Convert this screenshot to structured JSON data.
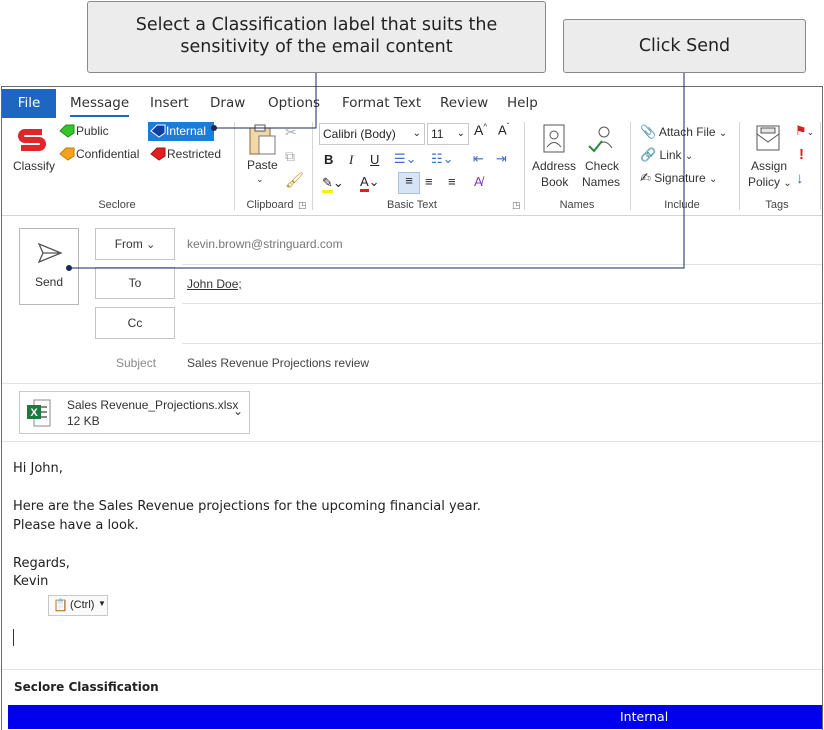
{
  "callouts": {
    "classify_line1": "Select a Classification label that suits the",
    "classify_line2": "sensitivity of the email content",
    "send": "Click Send"
  },
  "tabs": [
    "File",
    "Message",
    "Insert",
    "Draw",
    "Options",
    "Format Text",
    "Review",
    "Help"
  ],
  "ribbon": {
    "seclore": {
      "classify": "Classify",
      "labels": {
        "public": "Public",
        "confidential": "Confidential",
        "internal": "Internal",
        "restricted": "Restricted"
      },
      "group": "Seclore"
    },
    "clipboard": {
      "paste": "Paste",
      "group": "Clipboard"
    },
    "basic_text": {
      "font": "Calibri (Body)",
      "size": "11",
      "bold": "B",
      "italic": "I",
      "underline": "U",
      "group": "Basic Text"
    },
    "names": {
      "address_book_1": "Address",
      "address_book_2": "Book",
      "check_names_1": "Check",
      "check_names_2": "Names",
      "group": "Names"
    },
    "include": {
      "attach": "Attach File",
      "link": "Link",
      "signature": "Signature",
      "group": "Include"
    },
    "tags": {
      "assign_1": "Assign",
      "assign_2": "Policy",
      "group": "Tags"
    }
  },
  "compose": {
    "send": "Send",
    "from_label": "From",
    "from_value": "kevin.brown@stringuard.com",
    "to_label": "To",
    "to_value": "John Doe;",
    "cc_label": "Cc",
    "subject_label": "Subject",
    "subject_value": "Sales Revenue Projections review"
  },
  "attachment": {
    "name": "Sales Revenue_Projections.xlsx",
    "size": "12 KB"
  },
  "body": {
    "greeting": "Hi John,",
    "line1": "Here are the Sales Revenue projections for the upcoming financial year.",
    "line2": "Please have a look.",
    "regards": "Regards,",
    "name": "Kevin"
  },
  "paste_options": "(Ctrl)",
  "footer": {
    "title": "Seclore Classification",
    "classification": "Internal"
  },
  "colors": {
    "accent": "#1d67c3",
    "classification_bar": "#0000ee",
    "internal_tag": "#1e7bd6"
  }
}
